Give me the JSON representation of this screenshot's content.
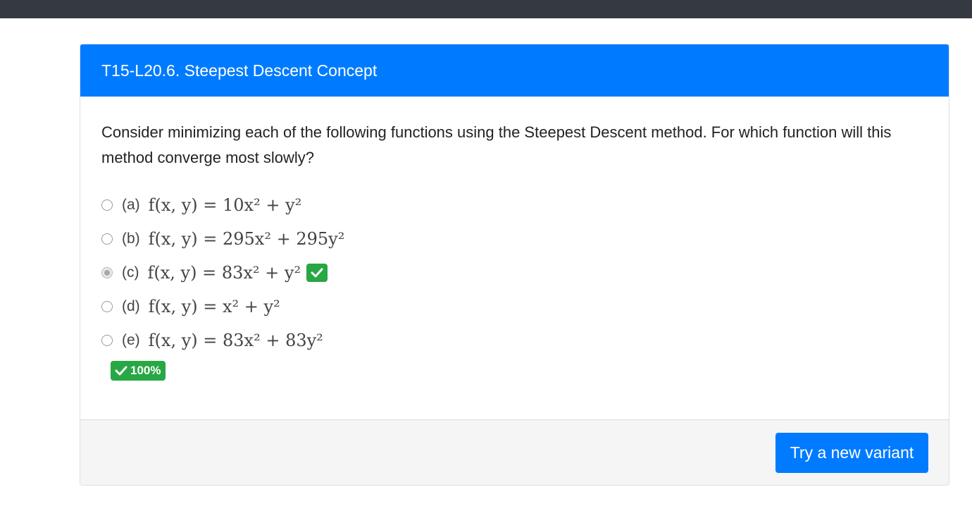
{
  "header": {
    "title": "T15-L20.6. Steepest Descent Concept"
  },
  "question": {
    "text": "Consider minimizing each of the following functions using the Steepest Descent method. For which function will this method converge most slowly?"
  },
  "options": [
    {
      "key": "(a)",
      "formula": "f(x, y) = 10x² + y²",
      "selected": false,
      "correct": false
    },
    {
      "key": "(b)",
      "formula": "f(x, y) = 295x² + 295y²",
      "selected": false,
      "correct": false
    },
    {
      "key": "(c)",
      "formula": "f(x, y) = 83x² + y²",
      "selected": true,
      "correct": true
    },
    {
      "key": "(d)",
      "formula": "f(x, y) = x² + y²",
      "selected": false,
      "correct": false
    },
    {
      "key": "(e)",
      "formula": "f(x, y) = 83x² + 83y²",
      "selected": false,
      "correct": false
    }
  ],
  "score": {
    "label": "100%",
    "icon": "check-icon",
    "color": "#28a745"
  },
  "footer": {
    "new_variant_label": "Try a new variant"
  },
  "colors": {
    "primary": "#007bff",
    "success": "#28a745",
    "topbar": "#343a40"
  }
}
